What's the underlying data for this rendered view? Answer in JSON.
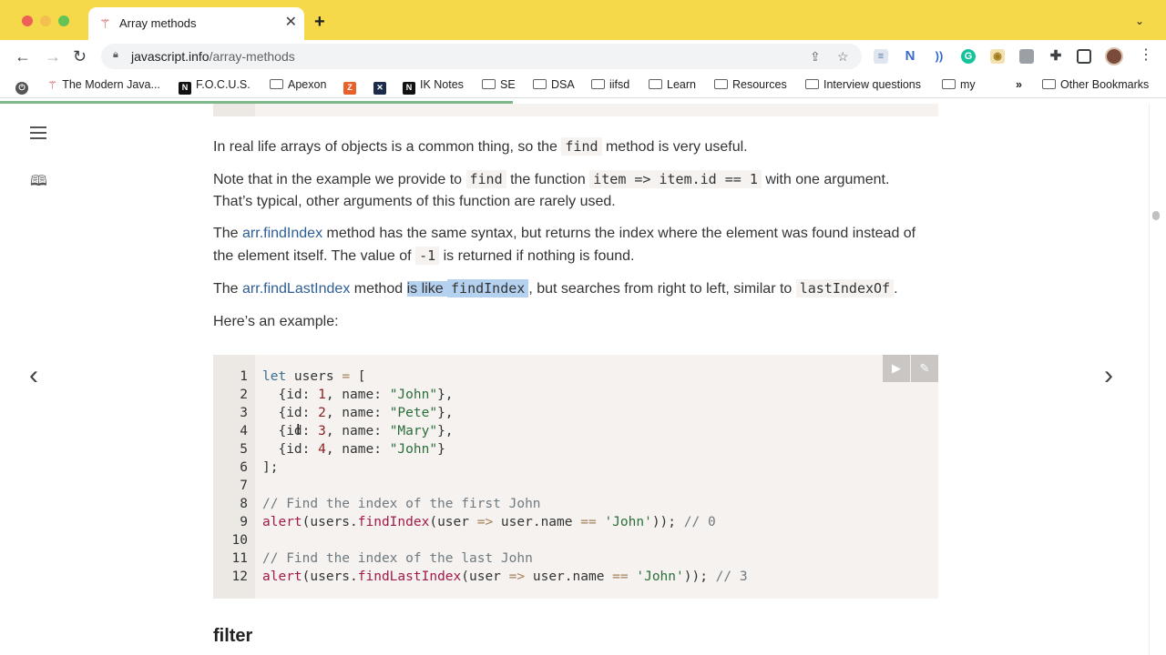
{
  "browser": {
    "tab_title": "Array methods",
    "tab_favicon": "javascript-info-icon",
    "url_domain": "javascript.info",
    "url_path": "/array-methods",
    "bookmarks": [
      {
        "label": "The Modern Java...",
        "icon": "javascript-info-icon"
      },
      {
        "label": "F.O.C.U.S.",
        "icon": "notion-icon"
      },
      {
        "label": "Apexon",
        "icon": "folder-icon"
      },
      {
        "label": "",
        "icon": "z-app-icon"
      },
      {
        "label": "",
        "icon": "x-app-icon"
      },
      {
        "label": "IK Notes",
        "icon": "notion-icon"
      },
      {
        "label": "SE",
        "icon": "folder-icon"
      },
      {
        "label": "DSA",
        "icon": "folder-icon"
      },
      {
        "label": "iifsd",
        "icon": "folder-icon"
      },
      {
        "label": "Learn",
        "icon": "folder-icon"
      },
      {
        "label": "Resources",
        "icon": "folder-icon"
      },
      {
        "label": "Interview questions",
        "icon": "folder-icon"
      },
      {
        "label": "my",
        "icon": "folder-icon"
      }
    ],
    "bookmarks_overflow": "»",
    "other_bookmarks": "Other Bookmarks",
    "page_load_progress": 0.44
  },
  "article": {
    "p1_a": "In real life arrays of objects is a common thing, so the ",
    "p1_code": "find",
    "p1_b": " method is very useful.",
    "p2_a": "Note that in the example we provide to ",
    "p2_code1": "find",
    "p2_b": " the function ",
    "p2_code2": "item => item.id == 1",
    "p2_c": " with one argument.",
    "p2_line2": "That’s typical, other arguments of this function are rarely used.",
    "p3_a": "The ",
    "p3_link": "arr.findIndex",
    "p3_b": " method has the same syntax, but returns the index where the element was found instead of",
    "p3_line2_a": "the element itself. The value of ",
    "p3_code": "-1",
    "p3_line2_b": " is returned if nothing is found.",
    "p4_a": "The ",
    "p4_link": "arr.findLastIndex",
    "p4_b": " method ",
    "p4_hl": "is like ",
    "p4_code1": "findIndex",
    "p4_c": ", but searches from right to left, similar to ",
    "p4_code2": "lastIndexOf",
    "p4_d": ".",
    "p5": "Here’s an example:",
    "next_heading": "filter"
  },
  "code": {
    "line_numbers": [
      "1",
      "2",
      "3",
      "4",
      "5",
      "6",
      "7",
      "8",
      "9",
      "10",
      "11",
      "12"
    ],
    "run_button": "run-icon",
    "edit_button": "edit-icon"
  }
}
